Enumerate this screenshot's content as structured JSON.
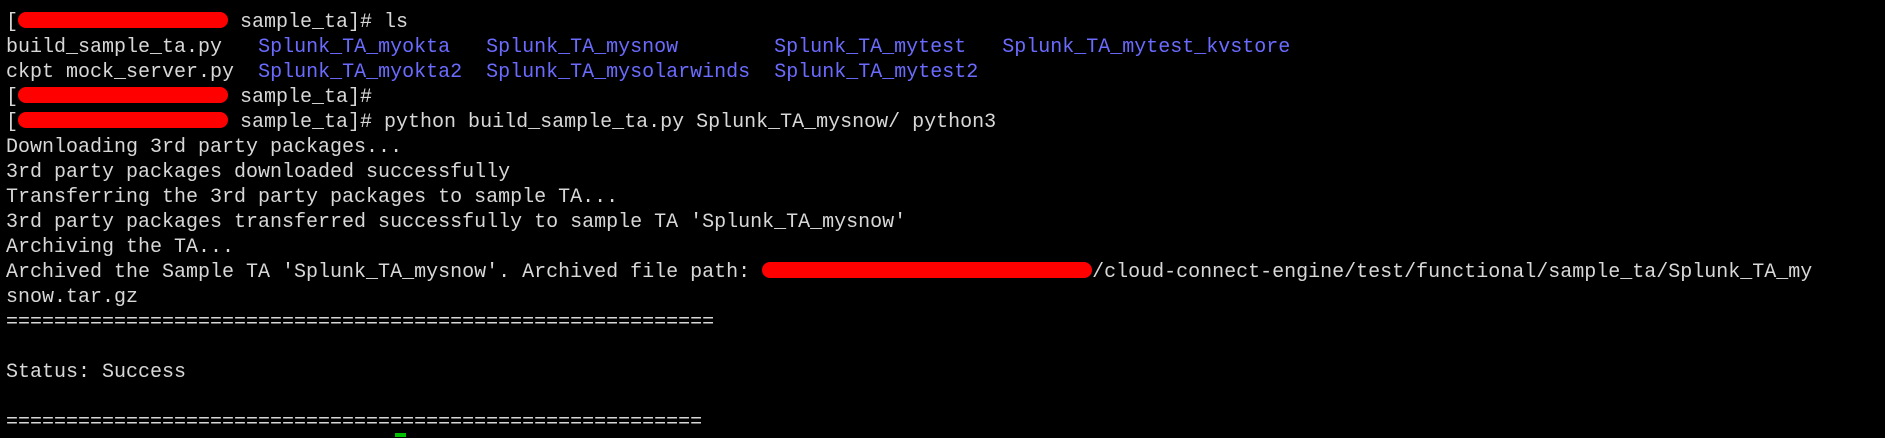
{
  "terminal": {
    "prompt_open": "[",
    "prompt_suffix": " sample_ta]# ",
    "cmd_ls": "ls",
    "cmd_build": "python build_sample_ta.py Splunk_TA_mysnow/ python3",
    "ls_rows": [
      {
        "file": "build_sample_ta.py",
        "file_sep": "   ",
        "dirs": [
          {
            "name": "Splunk_TA_myokta",
            "sep": "   "
          },
          {
            "name": "Splunk_TA_mysnow",
            "sep": "        "
          },
          {
            "name": "Splunk_TA_mytest",
            "sep": "   "
          },
          {
            "name": "Splunk_TA_mytest_kvstore",
            "sep": ""
          }
        ]
      },
      {
        "file": "ckpt mock_server.py",
        "file_sep": "  ",
        "dirs": [
          {
            "name": "Splunk_TA_myokta2",
            "sep": "  "
          },
          {
            "name": "Splunk_TA_mysolarwinds",
            "sep": "  "
          },
          {
            "name": "Splunk_TA_mytest2",
            "sep": ""
          }
        ]
      }
    ],
    "out_downloading": "Downloading 3rd party packages...",
    "out_downloaded": "3rd party packages downloaded successfully",
    "out_transferring": "Transferring the 3rd party packages to sample TA...",
    "out_transferred": "3rd party packages transferred successfully to sample TA 'Splunk_TA_mysnow'",
    "out_archiving": "Archiving the TA...",
    "out_archived_prefix": "Archived the Sample TA 'Splunk_TA_mysnow'. Archived file path: ",
    "out_archived_path": "/cloud-connect-engine/test/functional/sample_ta/Splunk_TA_my",
    "out_archived_wrap": "snow.tar.gz",
    "separator_1": "===========================================================",
    "blank_1": "",
    "status_line": "Status: Success",
    "blank_2": "",
    "separator_2": "=========================================================="
  },
  "colors": {
    "background": "#000000",
    "text": "#d8d8d8",
    "directory": "#6b6bff",
    "redaction": "#ff0000",
    "cursor": "#00c000"
  }
}
